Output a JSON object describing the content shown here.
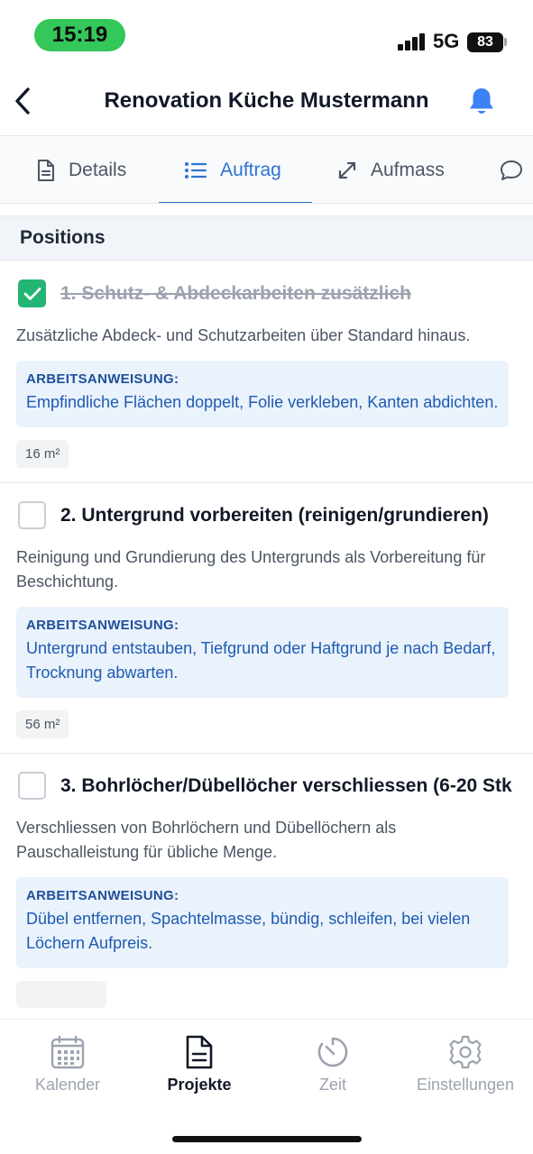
{
  "status_bar": {
    "time": "15:19",
    "network": "5G",
    "battery": "83"
  },
  "header": {
    "title": "Renovation Küche Mustermann",
    "back_icon": "chevron-left-icon",
    "bell_icon": "bell-icon"
  },
  "colors": {
    "accent": "#2f74d0",
    "check_green": "#22b573",
    "instruction_bg": "#eaf2fc",
    "status_pill": "#34c759"
  },
  "tabs": [
    {
      "label": "Details",
      "icon": "document-icon",
      "active": false
    },
    {
      "label": "Auftrag",
      "icon": "list-icon",
      "active": true
    },
    {
      "label": "Aufmass",
      "icon": "resize-arrows-icon",
      "active": false
    },
    {
      "label": "",
      "icon": "chat-bubble-icon",
      "active": false
    }
  ],
  "section": {
    "title": "Positions"
  },
  "positions": [
    {
      "title": "1. Schutz- & Abdeckarbeiten zusätzlich",
      "checked": true,
      "description": "Zusätzliche Abdeck- und Schutzarbeiten über Standard hinaus.",
      "instruction_label": "ARBEITSANWEISUNG:",
      "instruction": "Empfindliche Flächen doppelt, Folie verkleben, Kanten abdichten.",
      "quantity": "16 m²"
    },
    {
      "title": "2. Untergrund vorbereiten (reinigen/grundieren)",
      "checked": false,
      "description": "Reinigung und Grundierung des Untergrunds als Vorbereitung für Beschichtung.",
      "instruction_label": "ARBEITSANWEISUNG:",
      "instruction": "Untergrund entstauben, Tiefgrund oder Haftgrund je nach Bedarf, Trocknung abwarten.",
      "quantity": "56 m²"
    },
    {
      "title": "3. Bohrlöcher/Dübellöcher verschliessen (6-20 Stk",
      "checked": false,
      "description": "Verschliessen von Bohrlöchern und Dübellöchern als Pauschalleistung für übliche Menge.",
      "instruction_label": "ARBEITSANWEISUNG:",
      "instruction": "Dübel entfernen, Spachtelmasse, bündig, schleifen, bei vielen Löchern Aufpreis.",
      "quantity": ""
    }
  ],
  "bottom_nav": [
    {
      "label": "Kalender",
      "icon": "calendar-icon",
      "active": false
    },
    {
      "label": "Projekte",
      "icon": "document-icon",
      "active": true
    },
    {
      "label": "Zeit",
      "icon": "timer-icon",
      "active": false
    },
    {
      "label": "Einstellungen",
      "icon": "gear-icon",
      "active": false
    }
  ]
}
